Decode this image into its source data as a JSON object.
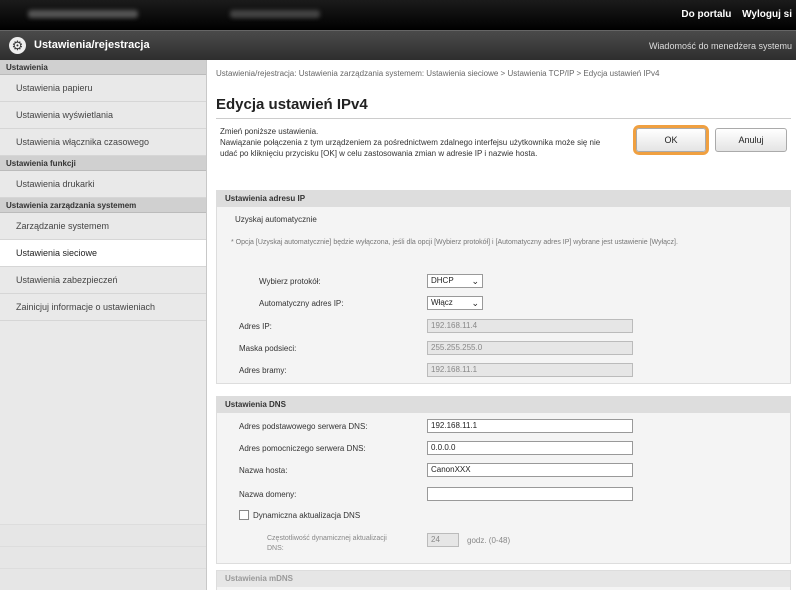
{
  "topbar": {
    "portal": "Do portalu",
    "logout": "Wyloguj si"
  },
  "header": {
    "title": "Ustawienia/rejestracja",
    "message": "Wiadomość do menedżera systemu"
  },
  "sidebar": {
    "sections": [
      {
        "title": "Ustawienia",
        "items": [
          "Ustawienia papieru",
          "Ustawienia wyświetlania",
          "Ustawienia włącznika czasowego"
        ]
      },
      {
        "title": "Ustawienia funkcji",
        "items": [
          "Ustawienia drukarki"
        ]
      },
      {
        "title": "Ustawienia zarządzania systemem",
        "items": [
          "Zarządzanie systemem",
          "Ustawienia sieciowe",
          "Ustawienia zabezpieczeń",
          "Zainicjuj informacje o ustawieniach"
        ]
      }
    ]
  },
  "main": {
    "breadcrumb": "Ustawienia/rejestracja: Ustawienia zarządzania systemem: Ustawienia sieciowe > Ustawienia TCP/IP > Edycja ustawień IPv4",
    "title": "Edycja ustawień IPv4",
    "intro": "Zmień poniższe ustawienia.\nNawiązanie połączenia z tym urządzeniem za pośrednictwem zdalnego interfejsu użytkownika może się nie udać po kliknięciu przycisku [OK] w celu zastosowania zmian w adresie IP i nazwie hosta.",
    "ok_label": "OK",
    "cancel_label": "Anuluj",
    "ip_panel": {
      "title": "Ustawienia adresu IP",
      "auto_label": "Uzyskaj automatycznie",
      "note": "* Opcja [Uzyskaj automatycznie] będzie wyłączona, jeśli dla opcji [Wybierz protokół] i [Automatyczny adres IP] wybrane jest ustawienie [Wyłącz].",
      "protocol_label": "Wybierz protokół:",
      "protocol_value": "DHCP",
      "autoip_label": "Automatyczny adres IP:",
      "autoip_value": "Włącz",
      "ip_label": "Adres IP:",
      "ip_value": "192.168.11.4",
      "mask_label": "Maska podsieci:",
      "mask_value": "255.255.255.0",
      "gateway_label": "Adres bramy:",
      "gateway_value": "192.168.11.1"
    },
    "dns_panel": {
      "title": "Ustawienia DNS",
      "primary_label": "Adres podstawowego serwera DNS:",
      "primary_value": "192.168.11.1",
      "secondary_label": "Adres pomocniczego serwera DNS:",
      "secondary_value": "0.0.0.0",
      "host_label": "Nazwa hosta:",
      "host_value": "CanonXXX",
      "domain_label": "Nazwa domeny:",
      "domain_value": "",
      "dynamic_label": "Dynamiczna aktualizacja DNS",
      "freq_label": "Częstotliwość dynamicznej aktualizacji DNS:",
      "freq_value": "24",
      "freq_unit": "godz. (0-48)"
    },
    "mdns_title": "Ustawienia mDNS"
  }
}
